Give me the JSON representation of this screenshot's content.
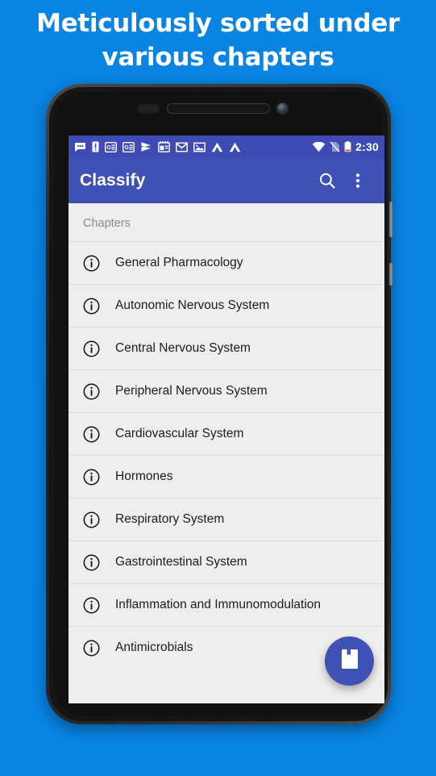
{
  "promo": {
    "line1": "Meticulously sorted under",
    "line2": "various chapters",
    "background_color": "#0984e3",
    "text_color": "#ffffff"
  },
  "device": {
    "body_color": "#1c1c1c",
    "earpiece_label": "earpiece-speaker",
    "camera_label": "front-camera"
  },
  "status_bar": {
    "background_color": "#3f4bb5",
    "time": "2:30",
    "icons": [
      "message-icon",
      "warning-icon",
      "news-icon",
      "news-icon-2",
      "play-icon",
      "calendar-icon",
      "gmail-icon",
      "photos-icon",
      "drive-icon",
      "drive-icon-2"
    ],
    "right_icons": [
      "wifi-icon",
      "no-sim-icon",
      "battery-icon"
    ]
  },
  "app_bar": {
    "title": "Classify",
    "background_color": "#3f51b5",
    "text_color": "#ffffff",
    "search_icon": "search-icon",
    "overflow_icon": "overflow-menu-icon"
  },
  "content": {
    "section_header": "Chapters",
    "background_color": "#eeeeee",
    "chapters": [
      {
        "label": "General Pharmacology",
        "icon": "info-icon"
      },
      {
        "label": "Autonomic Nervous System",
        "icon": "info-icon"
      },
      {
        "label": "Central Nervous System",
        "icon": "info-icon"
      },
      {
        "label": "Peripheral Nervous System",
        "icon": "info-icon"
      },
      {
        "label": "Cardiovascular System",
        "icon": "info-icon"
      },
      {
        "label": "Hormones",
        "icon": "info-icon"
      },
      {
        "label": "Respiratory System",
        "icon": "info-icon"
      },
      {
        "label": "Gastrointestinal System",
        "icon": "info-icon"
      },
      {
        "label": "Inflammation and Immunomodulation",
        "icon": "info-icon"
      },
      {
        "label": "Antimicrobials",
        "icon": "info-icon"
      }
    ]
  },
  "fab": {
    "icon": "bookmark-book-icon",
    "color": "#3f51b5"
  },
  "nav_bar": {
    "background_color": "#000000",
    "back": "back-triangle-icon",
    "home": "home-circle-icon",
    "recents": "recents-square-icon"
  }
}
